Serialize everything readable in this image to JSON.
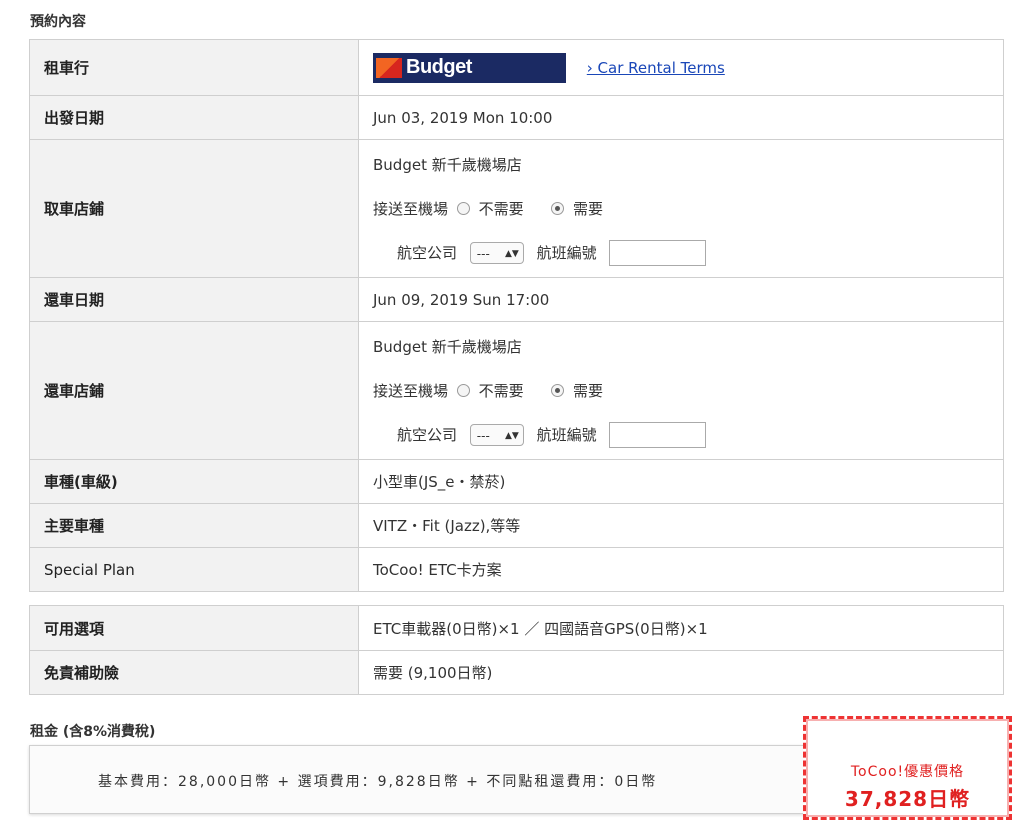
{
  "reservation": {
    "title": "預約內容",
    "rental_company": {
      "label": "租車行",
      "logo_text": "Budget",
      "terms_link": "› Car Rental Terms"
    },
    "departure_date": {
      "label": "出發日期",
      "value": "Jun 03, 2019 Mon 10:00"
    },
    "pickup_store": {
      "label": "取車店鋪",
      "store": "Budget 新千歲機場店",
      "shuttle_label": "接送至機場",
      "opt_no": "不需要",
      "opt_yes": "需要",
      "airline_label": "航空公司",
      "airline_value": "---",
      "flight_label": "航班編號"
    },
    "return_date": {
      "label": "還車日期",
      "value": "Jun 09, 2019 Sun 17:00"
    },
    "return_store": {
      "label": "還車店鋪",
      "store": "Budget 新千歲機場店",
      "shuttle_label": "接送至機場",
      "opt_no": "不需要",
      "opt_yes": "需要",
      "airline_label": "航空公司",
      "airline_value": "---",
      "flight_label": "航班編號"
    },
    "car_class": {
      "label": "車種(車級)",
      "value": "小型車(JS_e・禁菸)"
    },
    "main_models": {
      "label": "主要車種",
      "value": "VITZ・Fit (Jazz),等等"
    },
    "special_plan": {
      "label": "Special Plan",
      "value": "ToCoo! ETC卡方案"
    }
  },
  "options": {
    "available": {
      "label": "可用選項",
      "value": "ETC車載器(0日幣)×1 ／ 四國語音GPS(0日幣)×1"
    },
    "insurance": {
      "label": "免責補助險",
      "value": "需要 (9,100日幣)"
    }
  },
  "price": {
    "title": "租金 (含8%消費稅)",
    "breakdown": "基本費用：28,000日幣 + 選項費用：9,828日幣 + 不同點租還費用：0日幣",
    "promo_label": "ToCoo!優惠價格",
    "promo_value": "37,828日幣"
  },
  "colors": {
    "promo_red": "#e02020",
    "link_blue": "#1a47b8",
    "plan_brown": "#8a6a1a",
    "budget_navy": "#1b2a63"
  }
}
